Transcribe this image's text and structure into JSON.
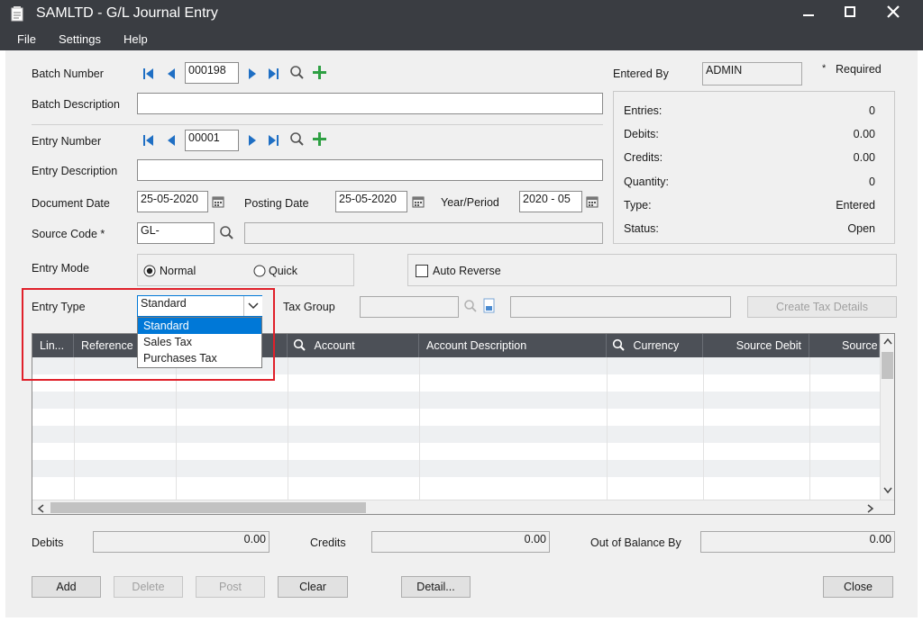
{
  "window": {
    "title": "SAMLTD - G/L Journal Entry"
  },
  "menu": {
    "file": "File",
    "settings": "Settings",
    "help": "Help"
  },
  "batch": {
    "number_label": "Batch Number",
    "number": "000198",
    "description_label": "Batch Description",
    "description": ""
  },
  "entered_by": {
    "label": "Entered By",
    "value": "ADMIN",
    "required_marker": "*",
    "required_label": "Required"
  },
  "summary": {
    "entries_label": "Entries:",
    "entries": "0",
    "debits_label": "Debits:",
    "debits": "0.00",
    "credits_label": "Credits:",
    "credits": "0.00",
    "quantity_label": "Quantity:",
    "quantity": "0",
    "type_label": "Type:",
    "type": "Entered",
    "status_label": "Status:",
    "status": "Open"
  },
  "entry": {
    "number_label": "Entry Number",
    "number": "00001",
    "description_label": "Entry Description",
    "description": "",
    "document_date_label": "Document Date",
    "document_date": "25-05-2020",
    "posting_date_label": "Posting Date",
    "posting_date": "25-05-2020",
    "year_period_label": "Year/Period",
    "year_period": "2020 - 05",
    "source_code_label": "Source Code *",
    "source_code": "GL-",
    "source_desc": "",
    "mode_label": "Entry Mode",
    "mode_normal": "Normal",
    "mode_quick": "Quick",
    "auto_reverse": "Auto Reverse",
    "type_label": "Entry Type",
    "type_value": "Standard",
    "type_options": [
      "Standard",
      "Sales Tax",
      "Purchases Tax"
    ],
    "tax_group_label": "Tax Group",
    "tax_group": "",
    "tax_group_desc": "",
    "create_tax_details": "Create Tax Details"
  },
  "grid": {
    "columns": [
      "Lin...",
      "Reference",
      "",
      "Account",
      "Account Description",
      "Currency",
      "Source Debit",
      "Source"
    ]
  },
  "totals": {
    "debits_label": "Debits",
    "debits": "0.00",
    "credits_label": "Credits",
    "credits": "0.00",
    "oob_label": "Out of Balance By",
    "oob": "0.00"
  },
  "buttons": {
    "add": "Add",
    "delete": "Delete",
    "post": "Post",
    "clear": "Clear",
    "detail": "Detail...",
    "close": "Close"
  },
  "colors": {
    "titlebar": "#3a3d42",
    "grid_header": "#4c5057",
    "highlight": "#0078d7",
    "annotation": "#e0202a",
    "nav_blue": "#1f6fc4",
    "add_green": "#2ea043"
  }
}
